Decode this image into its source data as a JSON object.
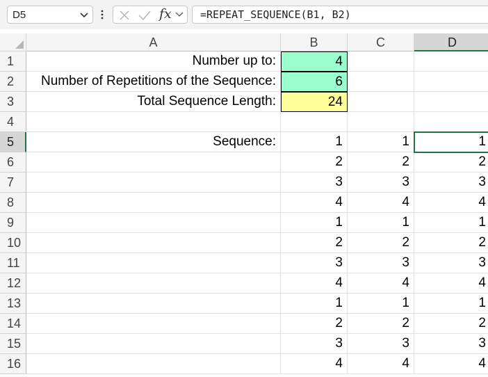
{
  "name_box": {
    "value": "D5"
  },
  "formula_bar": {
    "formula": "=REPEAT_SEQUENCE(B1, B2)",
    "fx_label": "fx"
  },
  "columns": [
    "A",
    "B",
    "C",
    "D"
  ],
  "rows": [
    "1",
    "2",
    "3",
    "4",
    "5",
    "6",
    "7",
    "8",
    "9",
    "10",
    "11",
    "12",
    "13",
    "14",
    "15",
    "16"
  ],
  "cells": {
    "A1": "Number up to:",
    "B1": "4",
    "A2": "Number of Repetitions of the Sequence:",
    "B2": "6",
    "A3": "Total Sequence Length:",
    "B3": "24",
    "A5": "Sequence:"
  },
  "sequence": {
    "B": [
      "1",
      "2",
      "3",
      "4",
      "1",
      "2",
      "3",
      "4",
      "1",
      "2",
      "3",
      "4"
    ],
    "C": [
      "1",
      "2",
      "3",
      "4",
      "1",
      "2",
      "3",
      "4",
      "1",
      "2",
      "3",
      "4"
    ],
    "D": [
      "1",
      "2",
      "3",
      "4",
      "1",
      "2",
      "3",
      "4",
      "1",
      "2",
      "3",
      "4"
    ]
  },
  "colors": {
    "input_fill": "#99ffcc",
    "result_fill": "#ffff99",
    "selection": "#217346"
  },
  "selected_cell": "D5"
}
